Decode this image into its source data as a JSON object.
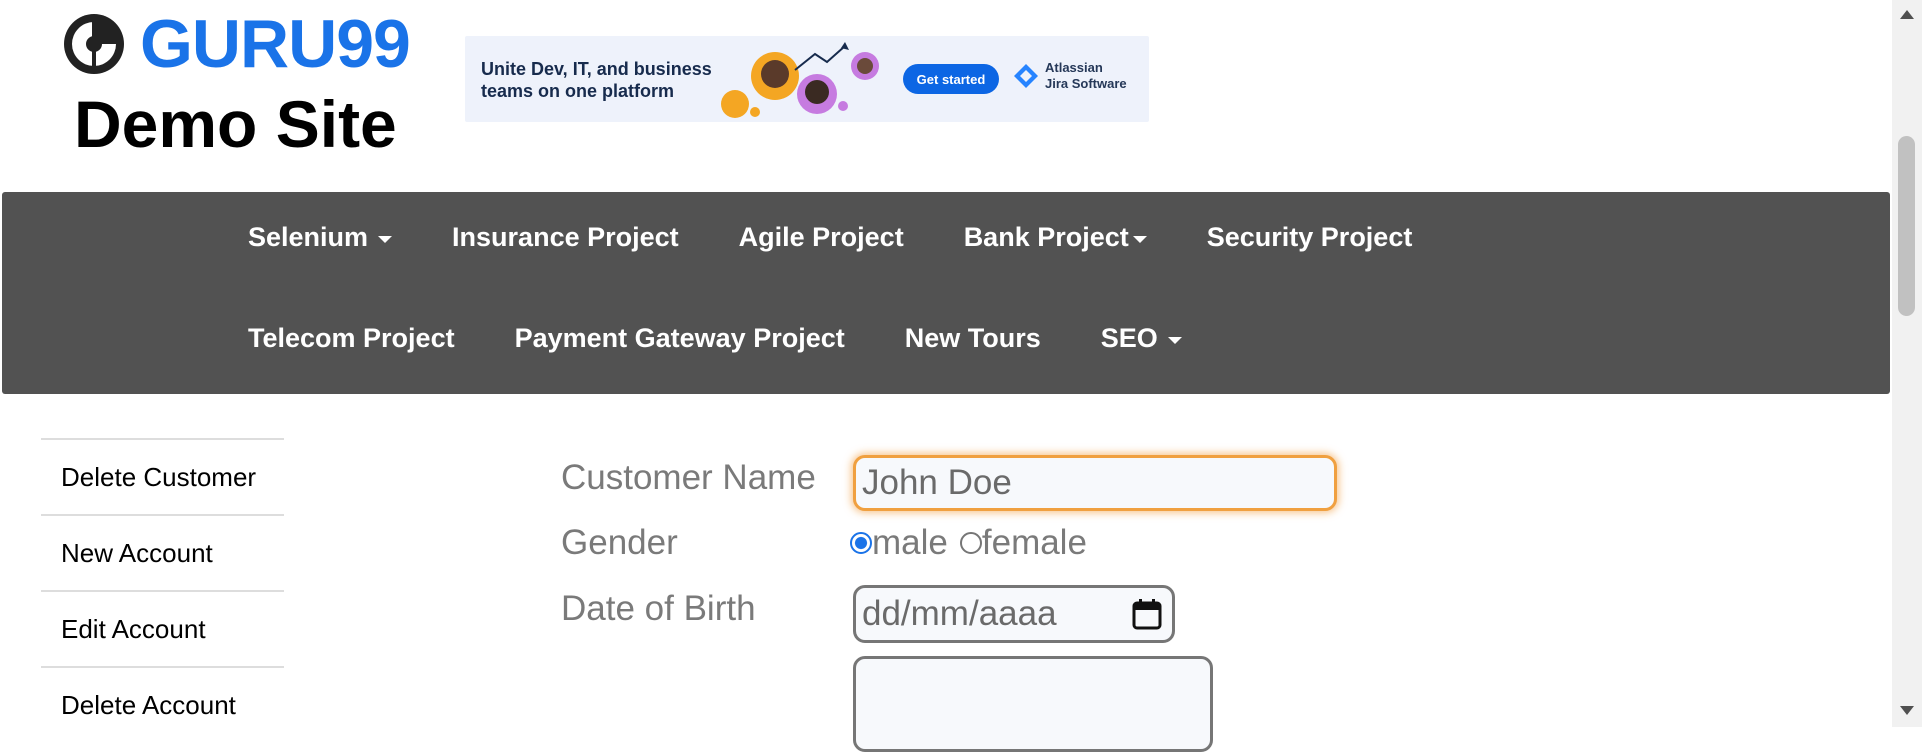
{
  "header": {
    "logo_text": "GURU99",
    "site_title": "Demo Site"
  },
  "ad": {
    "headline": "Unite Dev, IT, and business teams on one platform",
    "button_label": "Get started",
    "brand_line1": "Atlassian",
    "brand_line2": "Jira Software"
  },
  "nav": {
    "row1": [
      {
        "label": "Selenium",
        "dropdown": true
      },
      {
        "label": "Insurance Project",
        "dropdown": false
      },
      {
        "label": "Agile Project",
        "dropdown": false
      },
      {
        "label": "Bank Project",
        "dropdown": true
      },
      {
        "label": "Security Project",
        "dropdown": false
      }
    ],
    "row2": [
      {
        "label": "Telecom Project",
        "dropdown": false
      },
      {
        "label": "Payment Gateway Project",
        "dropdown": false
      },
      {
        "label": "New Tours",
        "dropdown": false
      },
      {
        "label": "SEO",
        "dropdown": true
      }
    ]
  },
  "sidebar": {
    "items": [
      {
        "label": "Delete Customer"
      },
      {
        "label": "New Account"
      },
      {
        "label": "Edit Account"
      },
      {
        "label": "Delete Account"
      }
    ]
  },
  "form": {
    "customer_name_label": "Customer Name",
    "customer_name_value": "John Doe",
    "gender_label": "Gender",
    "gender_male": "male",
    "gender_female": "female",
    "gender_selected": "male",
    "dob_label": "Date of Birth",
    "dob_placeholder": "dd/mm/aaaa"
  },
  "colors": {
    "accent": "#1a73e8",
    "nav_bg": "#525252",
    "focus_ring": "#f0a040"
  }
}
